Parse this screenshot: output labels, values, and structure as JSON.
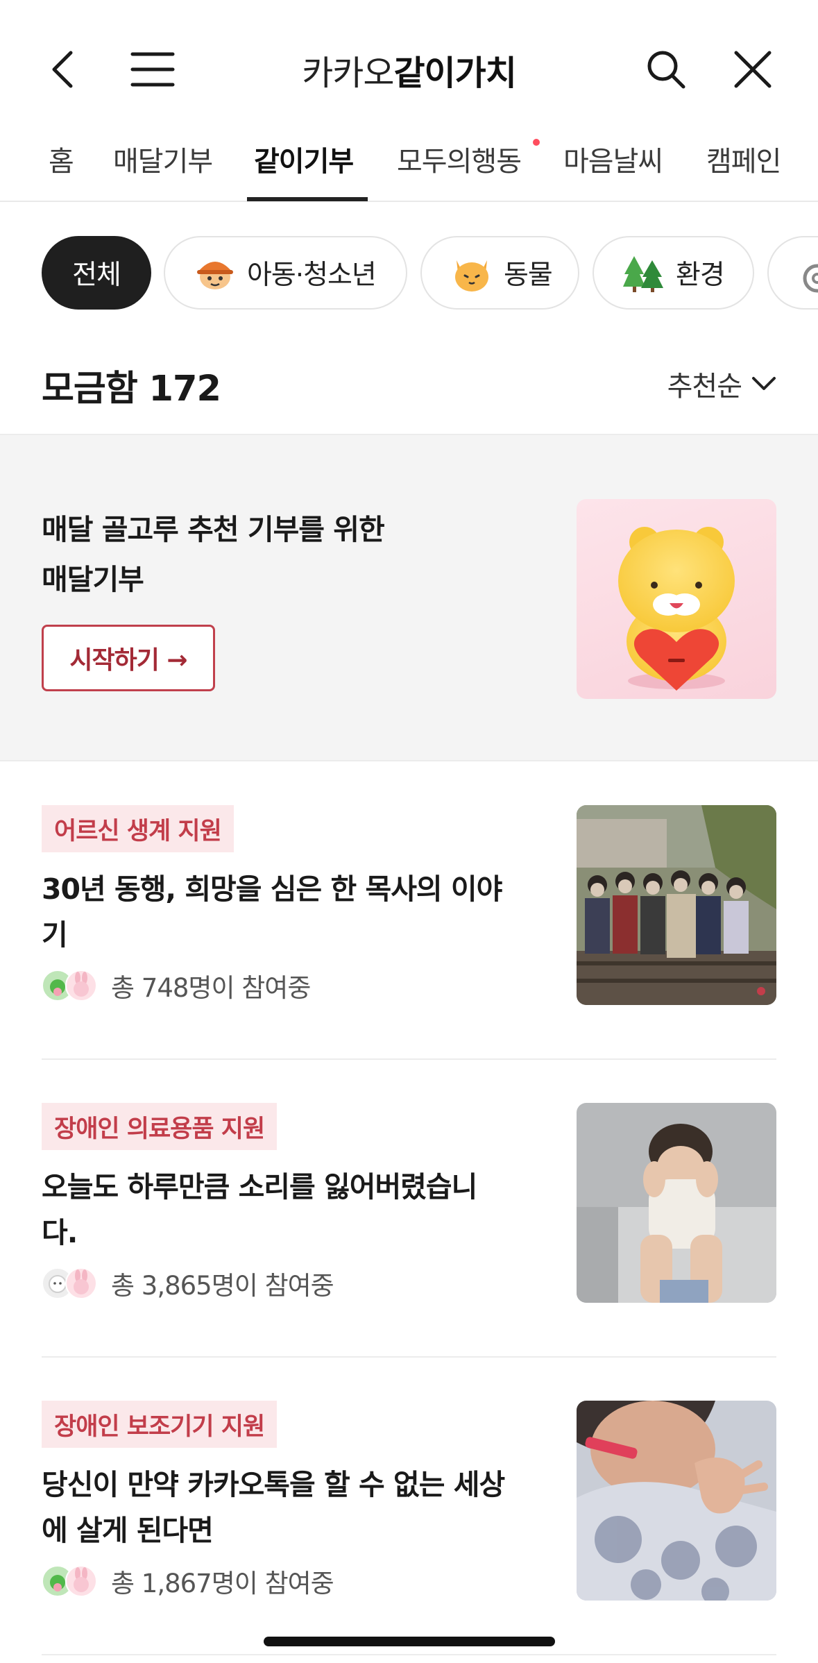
{
  "header": {
    "title_prefix": "카카오",
    "title_main": "같이가치"
  },
  "tabs": [
    {
      "label": "홈"
    },
    {
      "label": "매달기부"
    },
    {
      "label": "같이기부"
    },
    {
      "label": "모두의행동"
    },
    {
      "label": "마음날씨"
    },
    {
      "label": "캠페인"
    }
  ],
  "active_tab": "같이기부",
  "chips": [
    {
      "label": "전체",
      "icon": ""
    },
    {
      "label": "아동·청소년",
      "icon": "child-icon"
    },
    {
      "label": "동물",
      "icon": "cat-icon"
    },
    {
      "label": "환경",
      "icon": "trees-icon"
    }
  ],
  "count": {
    "label": "모금함 172"
  },
  "sort": {
    "label": "추천순"
  },
  "banner": {
    "line1": "매달 골고루 추천 기부를 위한",
    "line2": "매달기부",
    "button": "시작하기 →"
  },
  "items": [
    {
      "tag": "어르신 생계 지원",
      "title_line1": "30년 동행, 희망을 심은 한 목사의 이야",
      "title_line2": "기",
      "meta": "총 748명이 참여중"
    },
    {
      "tag": "장애인 의료용품 지원",
      "title_line1": "오늘도 하루만큼 소리를 잃어버렸습니",
      "title_line2": "다.",
      "meta": "총 3,865명이 참여중"
    },
    {
      "tag": "장애인 보조기기 지원",
      "title_line1": "당신이 만약 카카오톡을 할 수 없는 세상",
      "title_line2": "에 살게 된다면",
      "meta": "총 1,867명이 참여중"
    }
  ],
  "colors": {
    "accent": "#c23d4a",
    "tag_bg": "#fbe8ea",
    "active_chip": "#1f1f1f",
    "notification_dot": "#ff4d5e"
  }
}
